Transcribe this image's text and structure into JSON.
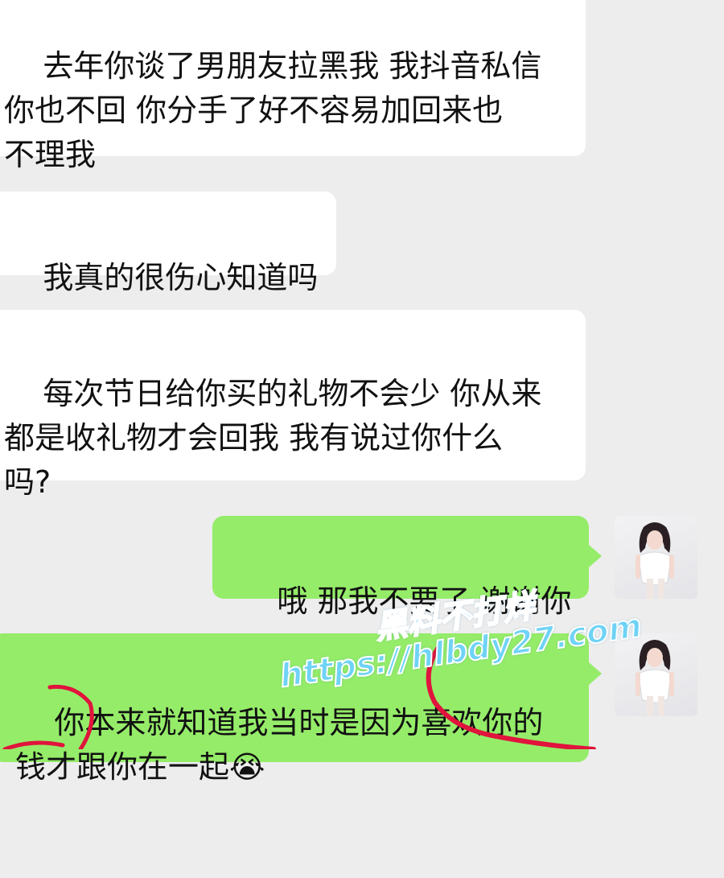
{
  "messages": [
    {
      "side": "incoming",
      "text": "去年你谈了男朋友拉黑我 我抖音私信\n你也不回 你分手了好不容易加回来也\n不理我"
    },
    {
      "side": "incoming",
      "text": "我真的很伤心知道吗"
    },
    {
      "side": "incoming",
      "text": "每次节日给你买的礼物不会少 你从来\n都是收礼物才会回我 我有说过你什么\n吗?"
    },
    {
      "side": "outgoing",
      "text": "哦 那我不要了 谢谢你"
    },
    {
      "side": "outgoing",
      "text": "你本来就知道我当时是因为喜欢你的\n钱才跟你在一起😭"
    }
  ],
  "watermark": {
    "line1": "黑料不打烊",
    "line2": "https://hlbdy27.com"
  },
  "colors": {
    "background": "#ededed",
    "incoming_bubble": "#ffffff",
    "outgoing_bubble": "#95ec69",
    "watermark": "#6fd3f5",
    "scribble": "#e0143c"
  },
  "icons": {
    "avatar": "avatar-icon"
  }
}
